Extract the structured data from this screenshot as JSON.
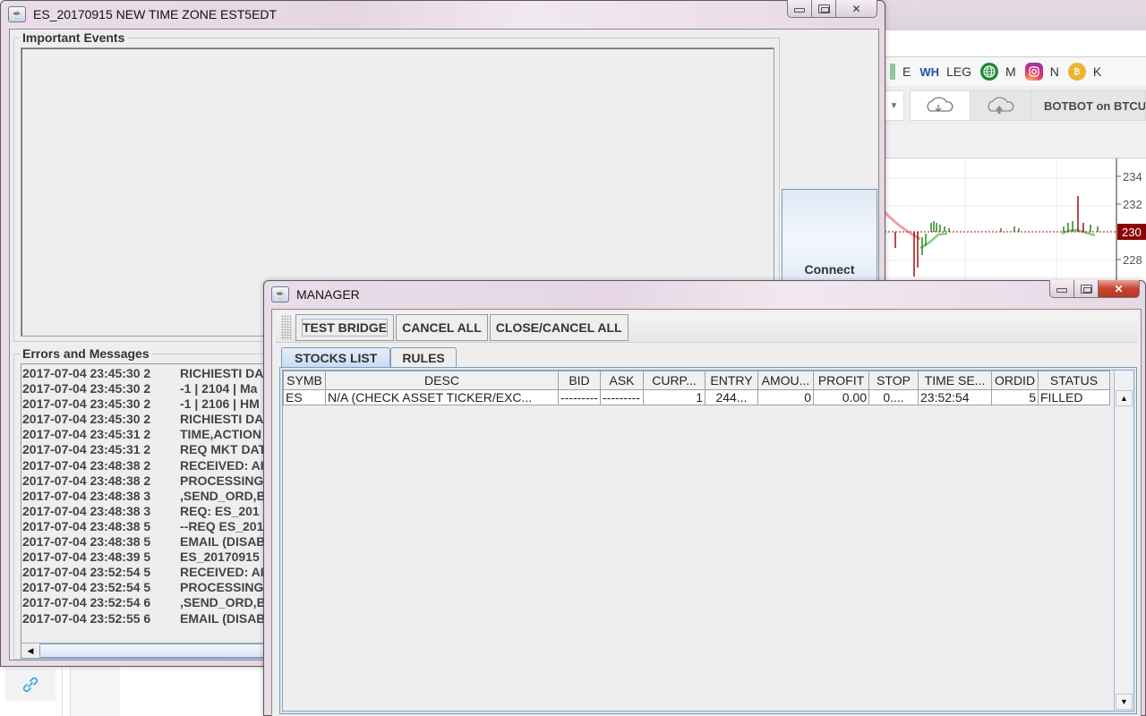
{
  "main_window": {
    "title": "ES_20170915 NEW TIME ZONE EST5EDT",
    "important_events_label": "Important Events",
    "errors_messages_label": "Errors and Messages",
    "connect_label": "Connect",
    "log": [
      {
        "ts": "2017-07-04 23:45:30 2",
        "msg": "RICHIESTI DA"
      },
      {
        "ts": "2017-07-04 23:45:30 2",
        "msg": "-1 | 2104 | Ma"
      },
      {
        "ts": "2017-07-04 23:45:30 2",
        "msg": "-1 | 2106 | HM"
      },
      {
        "ts": "2017-07-04 23:45:30 2",
        "msg": "RICHIESTI DA"
      },
      {
        "ts": "2017-07-04 23:45:31 2",
        "msg": "TIME,ACTION"
      },
      {
        "ts": "2017-07-04 23:45:31 2",
        "msg": "REQ MKT DAT"
      },
      {
        "ts": "2017-07-04 23:48:38 2",
        "msg": "RECEIVED: AI"
      },
      {
        "ts": "2017-07-04 23:48:38 2",
        "msg": "PROCESSING"
      },
      {
        "ts": "2017-07-04 23:48:38 3",
        "msg": ",SEND_ORD,B"
      },
      {
        "ts": "2017-07-04 23:48:38 3",
        "msg": "REQ: ES_201"
      },
      {
        "ts": "2017-07-04 23:48:38 5",
        "msg": "--REQ ES_201"
      },
      {
        "ts": "2017-07-04 23:48:38 5",
        "msg": "EMAIL (DISAB"
      },
      {
        "ts": "2017-07-04 23:48:39 5",
        "msg": "ES_20170915"
      },
      {
        "ts": "2017-07-04 23:52:54 5",
        "msg": "RECEIVED: AI"
      },
      {
        "ts": "2017-07-04 23:52:54 5",
        "msg": "PROCESSING"
      },
      {
        "ts": "2017-07-04 23:52:54 6",
        "msg": ",SEND_ORD,B"
      },
      {
        "ts": "2017-07-04 23:52:55 6",
        "msg": "EMAIL (DISAB"
      }
    ]
  },
  "manager_window": {
    "title": "MANAGER",
    "toolbar": {
      "test_bridge": "TEST BRIDGE",
      "cancel_all": "CANCEL ALL",
      "close_cancel_all": "CLOSE/CANCEL ALL"
    },
    "tabs": [
      {
        "label": "STOCKS LIST",
        "active": true
      },
      {
        "label": "RULES",
        "active": false
      }
    ],
    "table": {
      "columns": [
        "SYMB",
        "DESC",
        "BID",
        "ASK",
        "CURP...",
        "ENTRY",
        "AMOU...",
        "PROFIT",
        "STOP",
        "TIME SE...",
        "ORDID",
        "STATUS"
      ],
      "rows": [
        [
          "ES",
          "N/A (CHECK ASSET TICKER/EXC...",
          "---------",
          "---------",
          "1",
          "244...",
          "0",
          "0.00",
          "0....",
          "23:52:54",
          "5",
          "FILLED"
        ]
      ]
    }
  },
  "background_browser": {
    "bookmarks": [
      {
        "icon": "sheet-icon",
        "label": "E"
      },
      {
        "icon": "wh-logo-icon",
        "label": "LEG"
      },
      {
        "icon": "globe-icon",
        "label": "M"
      },
      {
        "icon": "instagram-icon",
        "label": "N"
      },
      {
        "icon": "bitcoin-icon",
        "label": "K"
      }
    ],
    "wh_logo_text": "WH",
    "breadcrumb": "BOTBOT on BTCUS",
    "price_axis": [
      "234",
      "232",
      "230",
      "228"
    ],
    "current_price_label": "230",
    "colors": {
      "up": "#1f8a1f",
      "down": "#a11010",
      "price_tag": "#8b0000"
    }
  }
}
